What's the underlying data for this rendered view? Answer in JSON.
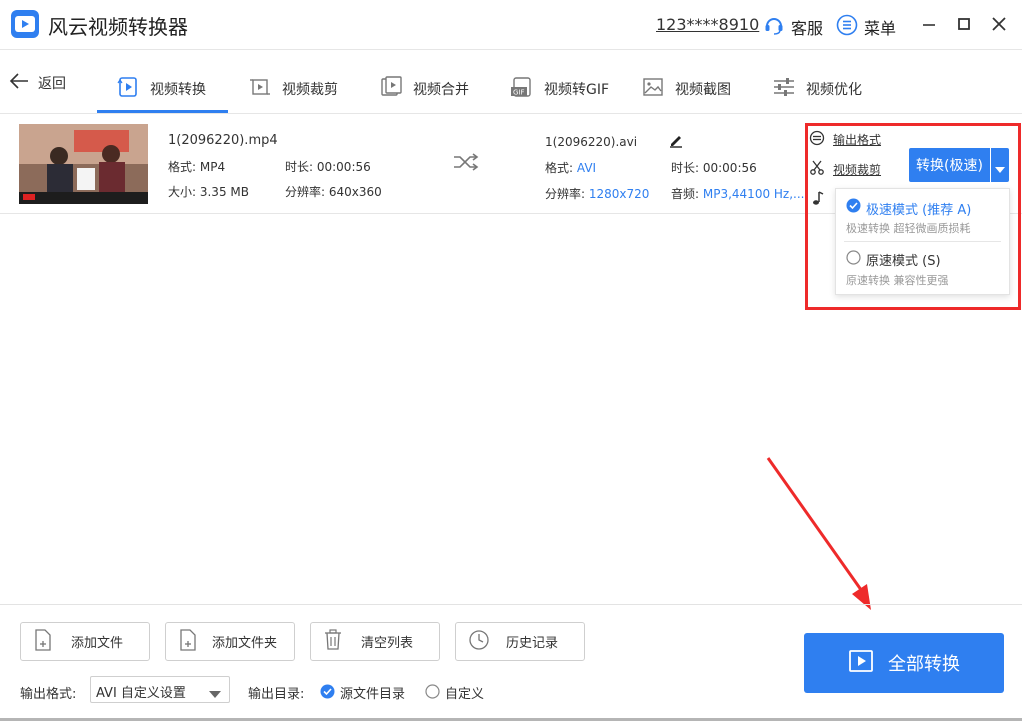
{
  "titlebar": {
    "app_title": "风云视频转换器",
    "account": "123****8910",
    "service_label": "客服",
    "menu_label": "菜单"
  },
  "nav": {
    "back_label": "返回",
    "tabs": [
      {
        "label": "视频转换",
        "icon": "video-convert-icon",
        "active": true
      },
      {
        "label": "视频裁剪",
        "icon": "video-crop-icon"
      },
      {
        "label": "视频合并",
        "icon": "video-merge-icon"
      },
      {
        "label": "视频转GIF",
        "icon": "gif-icon"
      },
      {
        "label": "视频截图",
        "icon": "screenshot-icon"
      },
      {
        "label": "视频优化",
        "icon": "optimize-icon"
      }
    ]
  },
  "file": {
    "source": {
      "name": "1(2096220).mp4",
      "format_label": "格式: MP4",
      "duration_label": "时长: 00:00:56",
      "size_label": "大小: 3.35 MB",
      "resolution_label": "分辨率: 640x360"
    },
    "output": {
      "name": "1(2096220).avi",
      "format_key": "格式:",
      "format_value": "AVI",
      "duration_label": "时长: 00:00:56",
      "resolution_key": "分辨率:",
      "resolution_value": "1280x720",
      "audio_key": "音频:",
      "audio_value": "MP3,44100 Hz,..."
    }
  },
  "panel": {
    "output_format_link": "输出格式",
    "video_crop_link": "视频裁剪",
    "convert_button": "转换(极速)",
    "options": [
      {
        "title": "极速模式 (推荐 A)",
        "subtitle": "极速转换 超轻微画质损耗",
        "selected": true
      },
      {
        "title": "原速模式 (S)",
        "subtitle": "原速转换 兼容性更强",
        "selected": false
      }
    ]
  },
  "bottom": {
    "add_file": "添加文件",
    "add_folder": "添加文件夹",
    "clear_list": "清空列表",
    "history": "历史记录",
    "convert_all": "全部转换",
    "format_label": "输出格式:",
    "format_value": "AVI 自定义设置",
    "dir_label": "输出目录:",
    "dir_options": [
      {
        "label": "源文件目录",
        "selected": true
      },
      {
        "label": "自定义",
        "selected": false
      }
    ]
  },
  "colors": {
    "accent": "#2f7ff0",
    "highlight": "#ee2a2a"
  }
}
